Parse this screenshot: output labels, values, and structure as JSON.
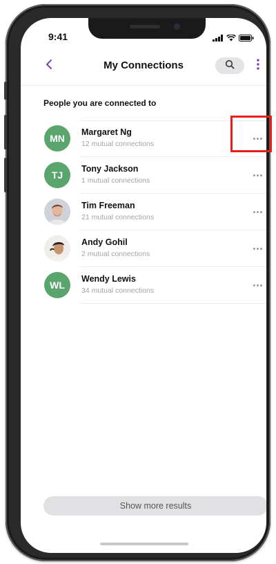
{
  "status_bar": {
    "time": "9:41"
  },
  "header": {
    "title": "My Connections"
  },
  "section": {
    "heading": "People you are connected to"
  },
  "connections": [
    {
      "name": "Margaret Ng",
      "mutual": "12 mutual connections",
      "initials": "MN",
      "avatar": "initials"
    },
    {
      "name": "Tony Jackson",
      "mutual": "1 mutual connections",
      "initials": "TJ",
      "avatar": "initials"
    },
    {
      "name": "Tim Freeman",
      "mutual": "21 mutual connections",
      "initials": "",
      "avatar": "photo"
    },
    {
      "name": "Andy Gohil",
      "mutual": "2 mutual connections",
      "initials": "",
      "avatar": "photo"
    },
    {
      "name": "Wendy Lewis",
      "mutual": "34 mutual connections",
      "initials": "WL",
      "avatar": "initials"
    }
  ],
  "footer": {
    "show_more_label": "Show more results"
  },
  "colors": {
    "accent": "#7b3fb5",
    "avatar_green": "#5aa56e",
    "highlight_red": "#e32118"
  }
}
